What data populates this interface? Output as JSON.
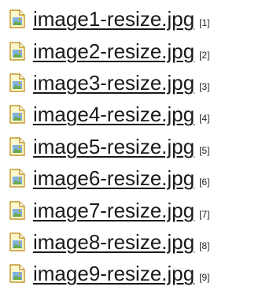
{
  "files": [
    {
      "name": "image1-resize.jpg",
      "ref": "[1]",
      "icon": "image-file-icon"
    },
    {
      "name": "image2-resize.jpg",
      "ref": "[2]",
      "icon": "image-file-icon"
    },
    {
      "name": "image3-resize.jpg",
      "ref": "[3]",
      "icon": "image-file-icon"
    },
    {
      "name": "image4-resize.jpg",
      "ref": "[4]",
      "icon": "image-file-icon"
    },
    {
      "name": "image5-resize.jpg",
      "ref": "[5]",
      "icon": "image-file-icon"
    },
    {
      "name": "image6-resize.jpg",
      "ref": "[6]",
      "icon": "image-file-icon"
    },
    {
      "name": "image7-resize.jpg",
      "ref": "[7]",
      "icon": "image-file-icon"
    },
    {
      "name": "image8-resize.jpg",
      "ref": "[8]",
      "icon": "image-file-icon"
    },
    {
      "name": "image9-resize.jpg",
      "ref": "[9]",
      "icon": "image-file-icon"
    }
  ],
  "colors": {
    "link": "#1a1a1a",
    "icon_page": "#fff7cc",
    "icon_border": "#b8860b",
    "icon_accent": "#e0a800",
    "icon_sky": "#7fb2e5",
    "icon_land": "#6aa84f"
  }
}
